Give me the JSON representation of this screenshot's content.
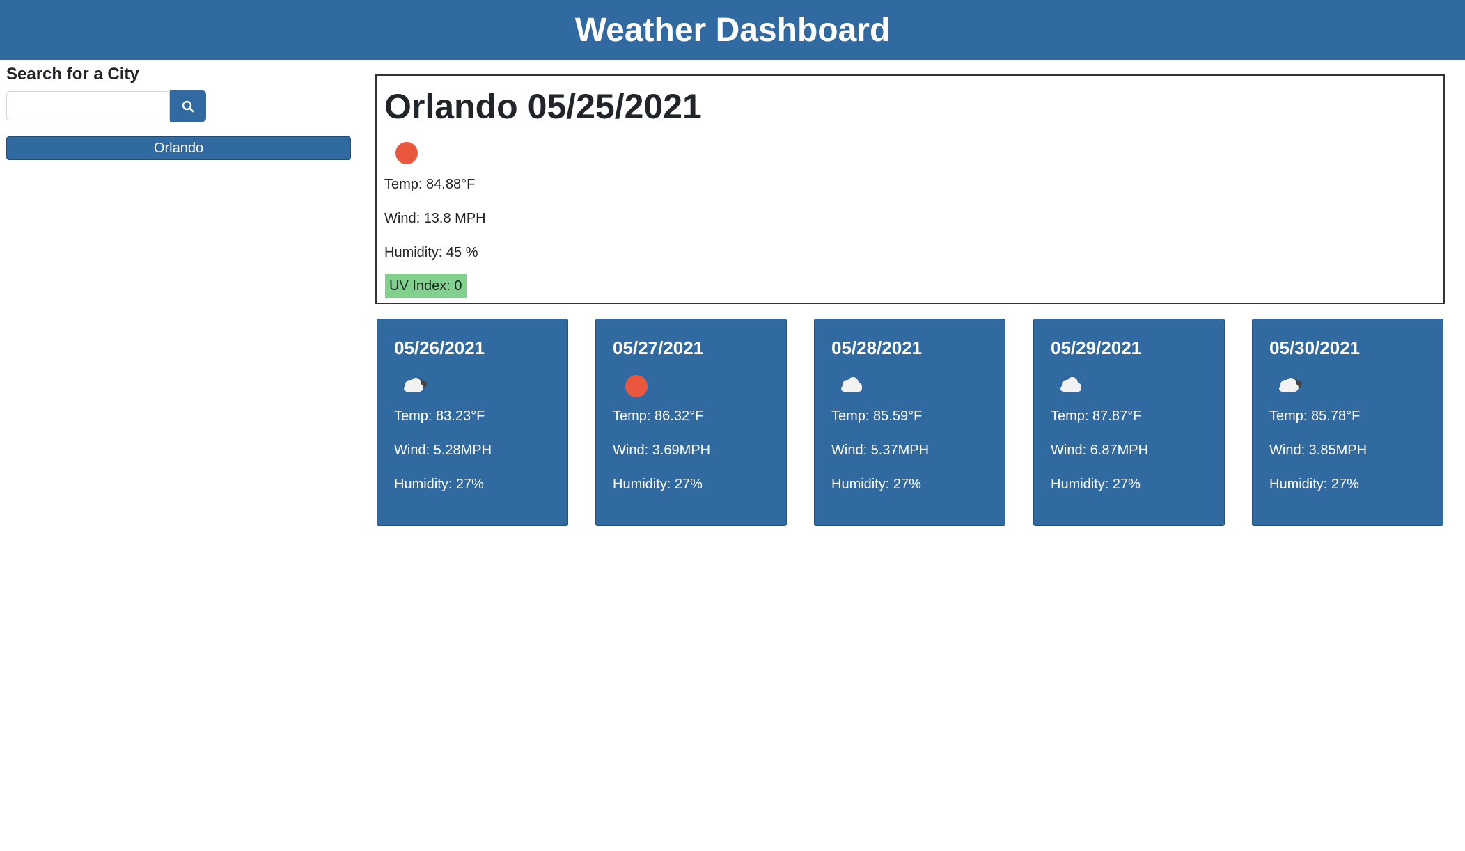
{
  "header": {
    "title": "Weather Dashboard"
  },
  "sidebar": {
    "search_label": "Search for a City",
    "search_value": "",
    "search_placeholder": "",
    "history": [
      "Orlando"
    ]
  },
  "current": {
    "title": "Orlando 05/25/2021",
    "icon": "sun-icon",
    "temp": "Temp: 84.88°F",
    "wind": "Wind: 13.8 MPH",
    "humidity": "Humidity: 45 %",
    "uv": "UV Index: 0",
    "uv_color": "#7fd18b"
  },
  "forecast": [
    {
      "date": "05/26/2021",
      "icon": "cloud-with-dark-cloud-icon",
      "temp": "Temp: 83.23°F",
      "wind": "Wind: 5.28MPH",
      "humidity": "Humidity: 27%"
    },
    {
      "date": "05/27/2021",
      "icon": "sun-icon",
      "temp": "Temp: 86.32°F",
      "wind": "Wind: 3.69MPH",
      "humidity": "Humidity: 27%"
    },
    {
      "date": "05/28/2021",
      "icon": "cloud-icon",
      "temp": "Temp: 85.59°F",
      "wind": "Wind: 5.37MPH",
      "humidity": "Humidity: 27%"
    },
    {
      "date": "05/29/2021",
      "icon": "cloud-icon",
      "temp": "Temp: 87.87°F",
      "wind": "Wind: 6.87MPH",
      "humidity": "Humidity: 27%"
    },
    {
      "date": "05/30/2021",
      "icon": "cloud-with-dark-cloud-icon",
      "temp": "Temp: 85.78°F",
      "wind": "Wind: 3.85MPH",
      "humidity": "Humidity: 27%"
    }
  ],
  "colors": {
    "brand": "#3169a1",
    "sun": "#e9573f",
    "uv_low": "#7fd18b"
  }
}
